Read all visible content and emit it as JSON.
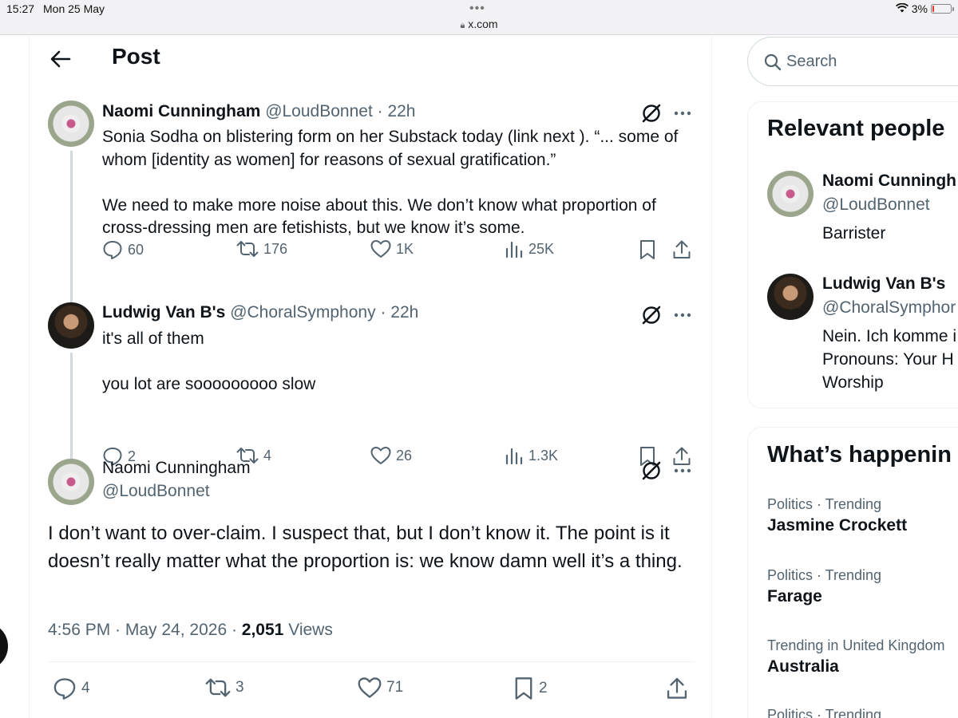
{
  "status_bar": {
    "time": "15:27",
    "date": "Mon 25 May",
    "url": "x.com",
    "battery": "3%",
    "battery_level": 0.03
  },
  "header": {
    "title": "Post"
  },
  "thread": [
    {
      "name": "Naomi Cunningham",
      "handle": "@LoudBonnet",
      "time": "· 22h",
      "text_1": "Sonia Sodha on blistering form on her Substack today (link next ). “... some of whom [identity as women] for reasons of sexual gratification.”",
      "text_2": "We need to make more noise about this. We don’t know what proportion of cross-dressing men are fetishists, but we know it’s some.",
      "replies": "60",
      "reposts": "176",
      "likes": "1K",
      "views": "25K"
    },
    {
      "name": "Ludwig Van B's",
      "handle": "@ChoralSymphony",
      "time": "· 22h",
      "text_1": "it's all of them",
      "text_2": "you lot are sooooooooo slow",
      "replies": "2",
      "reposts": "4",
      "likes": "26",
      "views": "1.3K"
    }
  ],
  "focus_post": {
    "name": "Naomi Cunningham",
    "handle": "@LoudBonnet",
    "text": "I don’t want to over-claim. I suspect that, but I don’t know it. The point is it doesn’t really matter what the proportion is: we know damn well it’s a thing.",
    "timestamp": "4:56 PM · May 24, 2026 ·",
    "views_count": "2,051",
    "views_label": "Views",
    "replies": "4",
    "reposts": "3",
    "likes": "71",
    "bookmarks": "2"
  },
  "search": {
    "placeholder": "Search"
  },
  "relevant_people": {
    "title": "Relevant people",
    "people": [
      {
        "name": "Naomi Cunningh",
        "handle": "@LoudBonnet",
        "bio": "Barrister"
      },
      {
        "name": "Ludwig Van B's",
        "handle": "@ChoralSymphor",
        "bio": "Nein. Ich komme i Pronouns: Your H Worship"
      }
    ]
  },
  "trends": {
    "title": "What’s happenin",
    "items": [
      {
        "meta": "Politics · Trending",
        "name": "Jasmine Crockett"
      },
      {
        "meta": "Politics · Trending",
        "name": "Farage"
      },
      {
        "meta": "Trending in United Kingdom",
        "name": "Australia"
      },
      {
        "meta": "Politics · Trending",
        "name": ""
      }
    ]
  },
  "colors": {
    "text_primary": "#0f1419",
    "text_secondary": "#536471",
    "border": "#eff3f4",
    "battery_low": "#e0362b"
  },
  "icons": [
    "back-arrow-icon",
    "grok-icon",
    "more-icon",
    "reply-icon",
    "repost-icon",
    "like-icon",
    "views-icon",
    "bookmark-icon",
    "share-icon",
    "search-icon",
    "wifi-icon",
    "battery-icon"
  ]
}
